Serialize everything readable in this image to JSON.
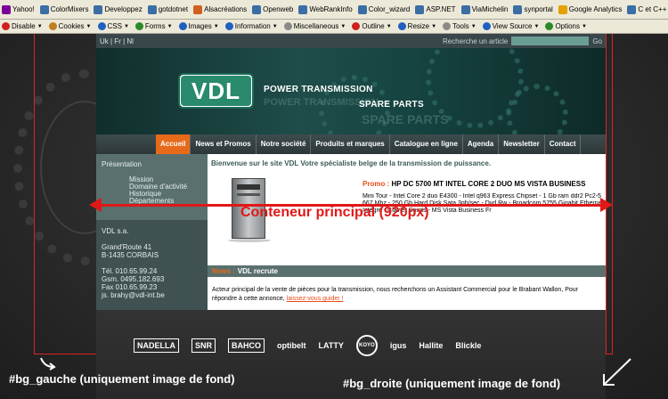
{
  "browser": {
    "bookmarks": [
      {
        "label": "Yahoo!",
        "icon": "yahoo-icon",
        "color": "#7b0099"
      },
      {
        "label": "ColorMixers",
        "icon": "page-icon",
        "color": "#3a6ea5"
      },
      {
        "label": "Developpez",
        "icon": "page-icon",
        "color": "#3a6ea5"
      },
      {
        "label": "gotdotnet",
        "icon": "page-icon",
        "color": "#3a6ea5"
      },
      {
        "label": "Alsacréations",
        "icon": "page-icon",
        "color": "#d06020"
      },
      {
        "label": "Openweb",
        "icon": "page-icon",
        "color": "#3a6ea5"
      },
      {
        "label": "WebRankInfo",
        "icon": "page-icon",
        "color": "#3a6ea5"
      },
      {
        "label": "Color_wizard",
        "icon": "page-icon",
        "color": "#3a6ea5"
      },
      {
        "label": "ASP.NET",
        "icon": "page-icon",
        "color": "#3a6ea5"
      },
      {
        "label": "ViaMichelin",
        "icon": "page-icon",
        "color": "#3a6ea5"
      },
      {
        "label": "synportal",
        "icon": "page-icon",
        "color": "#3a6ea5"
      },
      {
        "label": "Google Analytics",
        "icon": "google-icon",
        "color": "#e6a000"
      },
      {
        "label": "C et C++ !",
        "icon": "page-icon",
        "color": "#3a6ea5"
      }
    ],
    "devtools": [
      {
        "label": "Disable",
        "icon": "disable-icon",
        "color": "#d02020"
      },
      {
        "label": "Cookies",
        "icon": "cookies-icon",
        "color": "#c08020"
      },
      {
        "label": "CSS",
        "icon": "css-icon",
        "color": "#2060c0"
      },
      {
        "label": "Forms",
        "icon": "forms-icon",
        "color": "#2a8a2a"
      },
      {
        "label": "Images",
        "icon": "images-icon",
        "color": "#2060c0"
      },
      {
        "label": "Information",
        "icon": "info-icon",
        "color": "#2060c0"
      },
      {
        "label": "Miscellaneous",
        "icon": "misc-icon",
        "color": "#8a8a8a"
      },
      {
        "label": "Outline",
        "icon": "outline-icon",
        "color": "#d02020"
      },
      {
        "label": "Resize",
        "icon": "resize-icon",
        "color": "#2060c0"
      },
      {
        "label": "Tools",
        "icon": "tools-icon",
        "color": "#8a8a8a"
      },
      {
        "label": "View Source",
        "icon": "source-icon",
        "color": "#2060c0"
      },
      {
        "label": "Options",
        "icon": "options-icon",
        "color": "#2a8a2a"
      }
    ]
  },
  "site": {
    "languages": "Uk | Fr | Nl",
    "search_label": "Recherche un article",
    "search_go": "Go",
    "logo_text": "VDL",
    "tagline_1": "POWER TRANSMISSION",
    "tagline_2": "SPARE PARTS",
    "nav": [
      "Accueil",
      "News et Promos",
      "Notre société",
      "Produits et marques",
      "Catalogue en ligne",
      "Agenda",
      "Newsletter",
      "Contact"
    ],
    "sidebar": {
      "heading": "Présentation",
      "subitems": [
        "Mission",
        "Domaine d'activité",
        "Historique",
        "Départements"
      ],
      "company": "VDL s.a.",
      "address": [
        "Grand'Route 41",
        "B-1435 CORBAIS"
      ],
      "contacts": [
        "Tél. 010.65.99.24",
        "Gsm. 0495.182.693",
        "Fax 010.65.99.23",
        "js. brahy@vdl-int.be"
      ]
    },
    "welcome": "Bienvenue sur le site VDL Votre spécialiste belge de la transmission de puissance.",
    "promo_label": "Promo :",
    "promo_title": "HP DC 5700 MT INTEL CORE 2 DUO MS VISTA BUSINESS",
    "promo_desc": [
      "Mini Tour - Intel Core 2 duo E4300 - Intel q963 Express Chipset - 1 Gb ram ddr2 Pc2-5300",
      "667 Mhz - 250 Gb Hard Disk Sata 3gb/sec - Dvd Rw - Broadcom 5755 Gigabit Ethernet",
      "Intégré - Clavier Souris - MS Vista Business Fr"
    ],
    "news_label": "News :",
    "news_title": "VDL recrute",
    "news_text": "Acteur principal de la vente de pièces pour la transmission, nous recherchons un Assistant Commercial pour le Brabant Wallon, Pour répondre à cette annonce,",
    "news_link": "laissez-vous guider !",
    "partners": [
      "NADELLA",
      "SNR",
      "BAHCO",
      "optibelt",
      "LATTY",
      "KOYO",
      "igus",
      "Hallite",
      "Blickle"
    ]
  },
  "annotations": {
    "main_container": "Conteneur principal (920px)",
    "bg_left": "#bg_gauche (uniquement image de fond)",
    "bg_right": "#bg_droite (uniquement image de fond)"
  },
  "colors": {
    "accent": "#e66a1a",
    "annotation": "#e01818",
    "brand": "#2a8a6e"
  }
}
